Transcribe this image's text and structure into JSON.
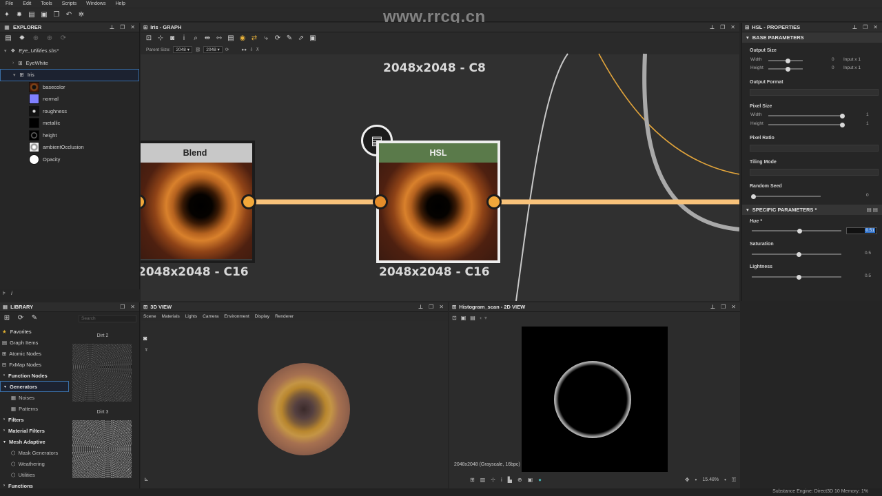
{
  "menu": [
    "File",
    "Edit",
    "Tools",
    "Scripts",
    "Windows",
    "Help"
  ],
  "watermark": "www.rrcg.cn",
  "explorer": {
    "title": "EXPLORER",
    "package": "Eye_Utilities.sbs*",
    "graphs": [
      "EyeWhite",
      "Iris"
    ],
    "outputs": [
      "basecolor",
      "normal",
      "roughness",
      "metallic",
      "height",
      "ambientOcclusion",
      "Opacity"
    ]
  },
  "graph": {
    "title": "Iris - GRAPH",
    "parent_size_label": "Parent Size:",
    "parent_size": "2048",
    "size_value": "2048",
    "top_label": "2048x2048 - C8",
    "blend_node": {
      "title": "Blend",
      "label": "2048x2048 - C16",
      "header_color": "#c8c8c8"
    },
    "hsl_node": {
      "title": "HSL",
      "label": "2048x2048 - C16",
      "header_color": "#5a7a4a"
    }
  },
  "properties": {
    "title": "HSL - PROPERTIES",
    "base_section": "BASE PARAMETERS",
    "output_size": "Output Size",
    "width_label": "Width",
    "height_label": "Height",
    "width_val": "0",
    "height_val": "0",
    "width_input": "Input x 1",
    "height_input": "Input x 1",
    "output_format": "Output Format",
    "pixel_size": "Pixel Size",
    "pixel_w_val": "1",
    "pixel_h_val": "1",
    "pixel_ratio": "Pixel Ratio",
    "tiling_mode": "Tiling Mode",
    "random_seed": "Random Seed",
    "random_seed_val": "0",
    "specific_section": "SPECIFIC PARAMETERS *",
    "hue_label": "Hue *",
    "hue_val": "0.51",
    "saturation_label": "Saturation",
    "saturation_val": "0.5",
    "lightness_label": "Lightness",
    "lightness_val": "0.5"
  },
  "library": {
    "title": "LIBRARY",
    "search_placeholder": "Search",
    "items": [
      {
        "label": "Favorites",
        "kind": "cat-star"
      },
      {
        "label": "Graph Items",
        "kind": "item"
      },
      {
        "label": "Atomic Nodes",
        "kind": "item"
      },
      {
        "label": "FxMap Nodes",
        "kind": "item"
      },
      {
        "label": "Function Nodes",
        "kind": "cat"
      },
      {
        "label": "Generators",
        "kind": "cat-selected"
      },
      {
        "label": "Noises",
        "kind": "sub"
      },
      {
        "label": "Patterns",
        "kind": "sub"
      },
      {
        "label": "Filters",
        "kind": "cat"
      },
      {
        "label": "Material Filters",
        "kind": "cat"
      },
      {
        "label": "Mesh Adaptive",
        "kind": "cat"
      },
      {
        "label": "Mask Generators",
        "kind": "sub"
      },
      {
        "label": "Weathering",
        "kind": "sub"
      },
      {
        "label": "Utilities",
        "kind": "sub"
      },
      {
        "label": "Functions",
        "kind": "cat"
      }
    ],
    "thumb1": "Dirt 2",
    "thumb2": "Dirt 3"
  },
  "view3d": {
    "title": "3D VIEW",
    "menu": [
      "Scene",
      "Materials",
      "Lights",
      "Camera",
      "Environment",
      "Display",
      "Renderer"
    ]
  },
  "view2d": {
    "title": "Histogram_scan - 2D VIEW",
    "info": "2048x2048 (Grayscale, 16bpc)",
    "zoom": "15.48%"
  },
  "status": {
    "engine": "Substance Engine: Direct3D 10  Memory: 1%"
  }
}
